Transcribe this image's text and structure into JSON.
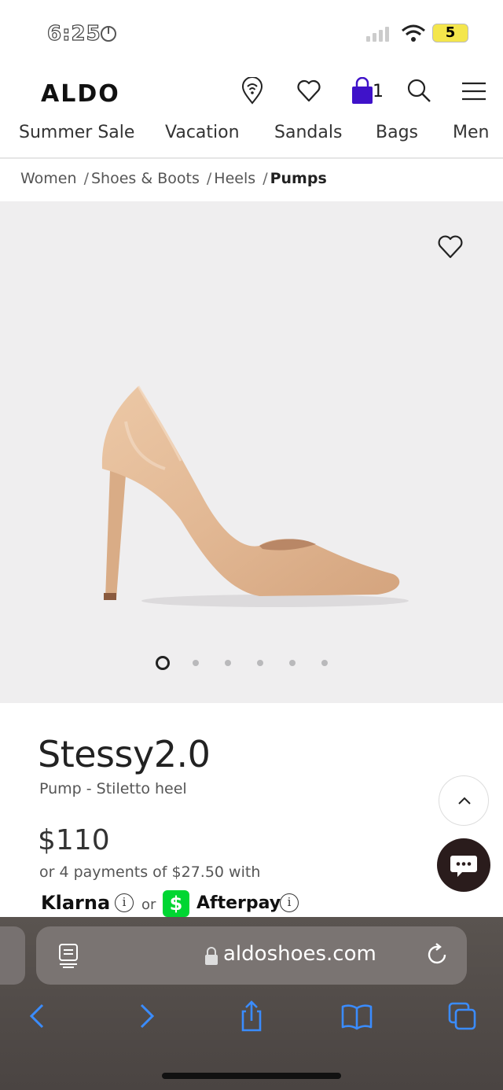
{
  "status_bar": {
    "time": "6:25",
    "battery": "5"
  },
  "header": {
    "logo": "ALDO",
    "bag_count": "1",
    "icons": [
      "store-locator-icon",
      "heart-icon",
      "shopping-bag-icon",
      "search-icon",
      "menu-icon"
    ]
  },
  "nav": {
    "items": [
      {
        "label": "Summer Sale"
      },
      {
        "label": "Vacation"
      },
      {
        "label": "Sandals"
      },
      {
        "label": "Bags"
      },
      {
        "label": "Men"
      }
    ]
  },
  "breadcrumb": {
    "items": [
      "Women",
      "Shoes & Boots",
      "Heels"
    ],
    "current": "Pumps",
    "separator": "/"
  },
  "gallery": {
    "dot_count": 6,
    "active_index": 0,
    "colors": {
      "background": "#efeeef",
      "shoe": "#e2b894"
    }
  },
  "product": {
    "name": "Stessy2.0",
    "subtitle": "Pump - Stiletto heel",
    "price": "$110",
    "installments": "or 4 payments of $27.50 with",
    "klarna": "Klarna",
    "or": "or",
    "cashapp_symbol": "$",
    "afterpay": "Afterpay",
    "info_symbol": "i"
  },
  "browser": {
    "url": "aldoshoes.com",
    "accent": "#3a8cff"
  }
}
